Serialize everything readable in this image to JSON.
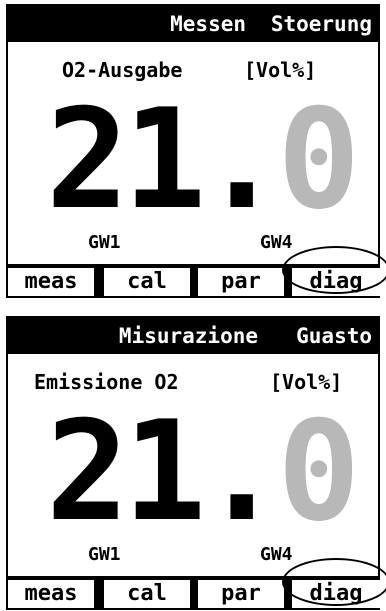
{
  "panels": [
    {
      "status": {
        "mode": "Messen",
        "state": "Stoerung"
      },
      "output_label": "O2-Ausgabe",
      "unit": "[Vol%]",
      "value": {
        "integer": "21",
        "decimal_point": ".",
        "fraction": "0"
      },
      "limits": {
        "left": "GW1",
        "right": "GW4"
      },
      "softkeys": [
        "meas",
        "cal",
        "par",
        "diag"
      ]
    },
    {
      "status": {
        "mode": "Misurazione",
        "state": "Guasto"
      },
      "output_label": "Emissione O2",
      "unit": "[Vol%]",
      "value": {
        "integer": "21",
        "decimal_point": ".",
        "fraction": "0"
      },
      "limits": {
        "left": "GW1",
        "right": "GW4"
      },
      "softkeys": [
        "meas",
        "cal",
        "par",
        "diag"
      ]
    }
  ],
  "colors": {
    "background": "#ffffff",
    "foreground": "#000000",
    "dimmed_digit": "#b8b8b8"
  },
  "highlighted_softkey": "diag"
}
